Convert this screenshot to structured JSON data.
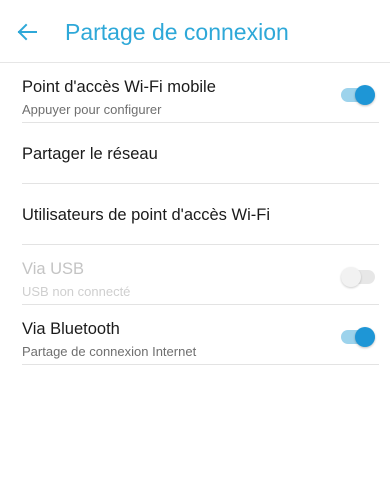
{
  "app_bar": {
    "back_icon": "arrow-left-icon",
    "title": "Partage de connexion"
  },
  "colors": {
    "accent": "#2ea8d8",
    "toggle_on": "#1e96d6",
    "disabled_text": "#c4c4c4"
  },
  "settings": [
    {
      "title": "Point d'accès Wi-Fi mobile",
      "summary": "Appuyer pour configurer",
      "toggle": "on",
      "enabled": true
    },
    {
      "title": "Partager le réseau",
      "enabled": true
    },
    {
      "title": "Utilisateurs de point d'accès Wi-Fi",
      "enabled": true
    },
    {
      "title": "Via USB",
      "summary": "USB non connecté",
      "toggle": "off",
      "enabled": false
    },
    {
      "title": "Via Bluetooth",
      "summary": "Partage de connexion Internet",
      "toggle": "on",
      "enabled": true
    }
  ]
}
